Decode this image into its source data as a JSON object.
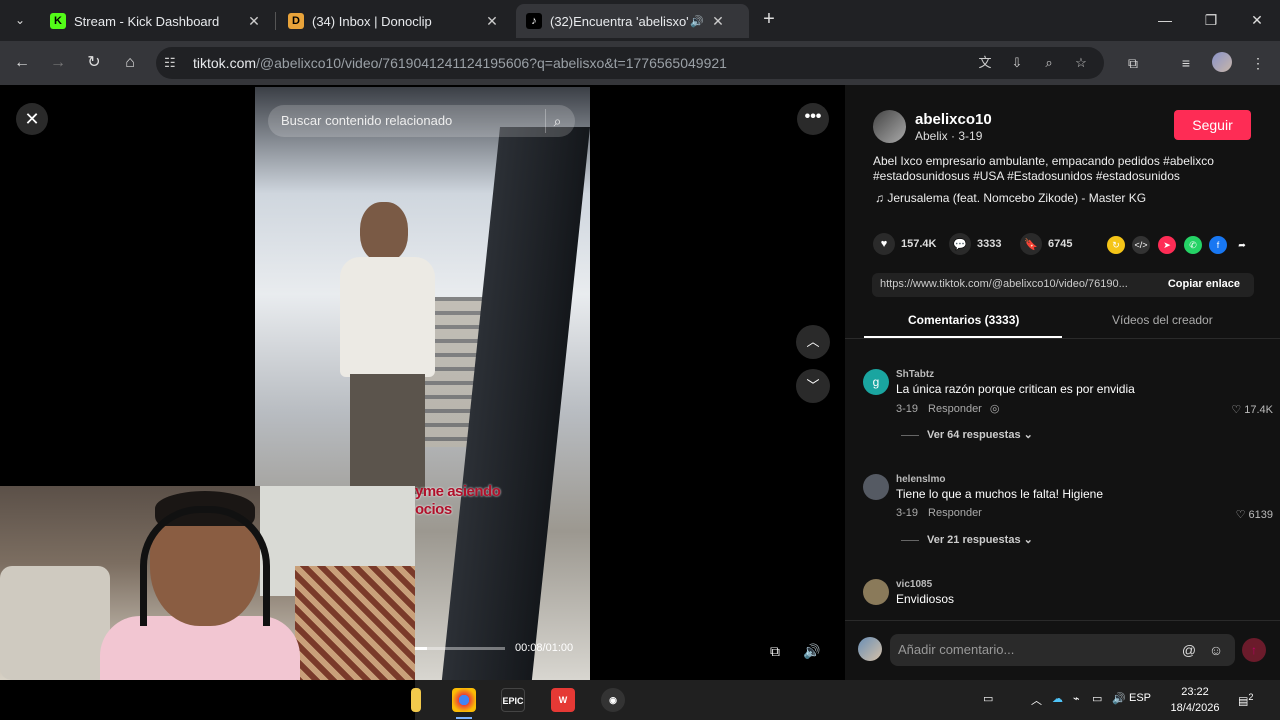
{
  "browser": {
    "tabs": [
      {
        "title": "Stream - Kick Dashboard",
        "icon": "kick-icon"
      },
      {
        "title": "(34) Inbox | Donoclip",
        "icon": "donoclip-icon"
      },
      {
        "title": "(32)Encuentra 'abelisxo' en",
        "icon": "tiktok-icon"
      }
    ],
    "url_host": "tiktok.com",
    "url_rest": "/@abelixco10/video/7619041241124195606?q=abelisxo&t=1776565049921"
  },
  "video": {
    "search_placeholder": "Buscar contenido relacionado",
    "caption_overlay_line1": "yme asiendo",
    "caption_overlay_line2": "ocios",
    "time": "00:08/01:00",
    "progress": 0.13
  },
  "author": {
    "username": "abelixco10",
    "subtitle": "Abelix · 3-19",
    "follow_label": "Seguir"
  },
  "description": "Abel Ixco empresario ambulante, empacando pedidos #abelixco #estadosunidosus #USA #Estadosunidos #estadosunidos",
  "music": "Jerusalema (feat. Nomcebo Zikode) - Master KG",
  "stats": {
    "likes": "157.4K",
    "comments": "3333",
    "saves": "6745"
  },
  "link": {
    "url": "https://www.tiktok.com/@abelixco10/video/76190...",
    "copy_label": "Copiar enlace"
  },
  "panel_tabs": {
    "comments": "Comentarios (3333)",
    "creator_videos": "Vídeos del creador"
  },
  "comments": [
    {
      "user": "ShTabtz",
      "text": "La única razón porque critican es por envidia",
      "date": "3-19",
      "reply_label": "Responder",
      "likes": "17.4K",
      "replies": "Ver 64 respuestas",
      "avatar_letter": "g",
      "avatar_color": "#1aa5a0"
    },
    {
      "user": "helenslmo",
      "text": "Tiene lo que a muchos le falta! Higiene",
      "date": "3-19",
      "reply_label": "Responder",
      "likes": "6139",
      "replies": "Ver 21 respuestas",
      "avatar_letter": "",
      "avatar_color": "#555a63"
    },
    {
      "user": "vic1085",
      "text": "Envidiosos",
      "date": "",
      "reply_label": "",
      "likes": "",
      "replies": "",
      "avatar_letter": "",
      "avatar_color": "#8a7a5a"
    }
  ],
  "comment_input": {
    "placeholder": "Añadir comentario..."
  },
  "taskbar": {
    "language": "ESP",
    "time": "23:22",
    "date": "18/4/2026",
    "notifications": "2"
  }
}
